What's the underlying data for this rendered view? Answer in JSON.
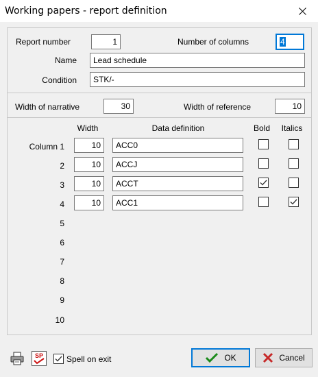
{
  "window": {
    "title": "Working papers - report definition"
  },
  "header": {
    "report_number_label": "Report number",
    "report_number_value": "1",
    "number_of_columns_label": "Number of columns",
    "number_of_columns_value": "4",
    "name_label": "Name",
    "name_value": "Lead schedule",
    "condition_label": "Condition",
    "condition_value": "STK/-"
  },
  "widths": {
    "narrative_label": "Width of narrative",
    "narrative_value": "30",
    "reference_label": "Width of reference",
    "reference_value": "10"
  },
  "columns_table": {
    "headers": {
      "width": "Width",
      "data_definition": "Data definition",
      "bold": "Bold",
      "italics": "Italics"
    },
    "rows": [
      {
        "label": "Column 1",
        "width": "10",
        "definition": "ACC0",
        "bold": false,
        "italics": false
      },
      {
        "label": "2",
        "width": "10",
        "definition": "ACCJ",
        "bold": false,
        "italics": false
      },
      {
        "label": "3",
        "width": "10",
        "definition": "ACCT",
        "bold": true,
        "italics": false
      },
      {
        "label": "4",
        "width": "10",
        "definition": "ACC1",
        "bold": false,
        "italics": true
      },
      {
        "label": "5"
      },
      {
        "label": "6"
      },
      {
        "label": "7"
      },
      {
        "label": "8"
      },
      {
        "label": "9"
      },
      {
        "label": "10"
      }
    ]
  },
  "footer": {
    "spell_on_exit_label": "Spell on exit",
    "spell_on_exit_checked": true,
    "spell_icon_text": "SP",
    "ok_label": "OK",
    "cancel_label": "Cancel"
  },
  "icons": [
    "close-icon",
    "printer-icon",
    "spell-check-icon",
    "checkmark-icon",
    "cancel-x-icon"
  ],
  "colors": {
    "focus_blue": "#0078d7",
    "ok_green": "#1a8a1a",
    "cancel_red": "#c62828"
  }
}
